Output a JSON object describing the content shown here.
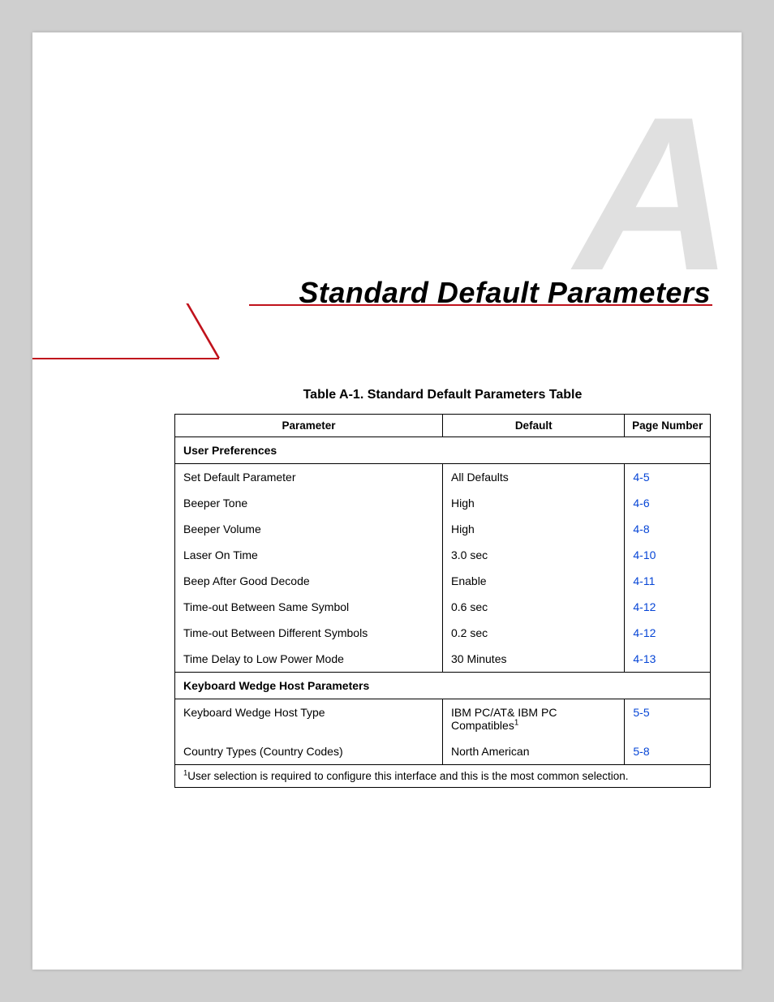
{
  "appendix_letter": "A",
  "heading": "Standard Default Parameters",
  "table_caption": "Table A-1.  Standard Default Parameters Table",
  "columns": {
    "parameter": "Parameter",
    "default": "Default",
    "page": "Page Number"
  },
  "sections": [
    {
      "title": "User Preferences",
      "rows": [
        {
          "parameter": "Set Default Parameter",
          "default": "All Defaults",
          "page": "4-5"
        },
        {
          "parameter": "Beeper Tone",
          "default": "High",
          "page": "4-6"
        },
        {
          "parameter": "Beeper Volume",
          "default": "High",
          "page": "4-8"
        },
        {
          "parameter": "Laser On Time",
          "default": "3.0 sec",
          "page": "4-10"
        },
        {
          "parameter": "Beep After Good Decode",
          "default": "Enable",
          "page": "4-11"
        },
        {
          "parameter": "Time-out Between Same Symbol",
          "default": "0.6 sec",
          "page": "4-12"
        },
        {
          "parameter": "Time-out Between Different Symbols",
          "default": "0.2 sec",
          "page": "4-12"
        },
        {
          "parameter": "Time Delay to Low Power Mode",
          "default": "30 Minutes",
          "page": "4-13"
        }
      ]
    },
    {
      "title": "Keyboard Wedge Host Parameters",
      "rows": [
        {
          "parameter": "Keyboard Wedge Host Type",
          "default": "IBM PC/AT& IBM PC Compatibles",
          "default_sup": "1",
          "page": "5-5"
        },
        {
          "parameter": "Country Types (Country Codes)",
          "default": "North American",
          "page": "5-8"
        }
      ]
    }
  ],
  "footnote": {
    "marker": "1",
    "text": "User selection is required to configure this interface and this is the most common selection."
  }
}
